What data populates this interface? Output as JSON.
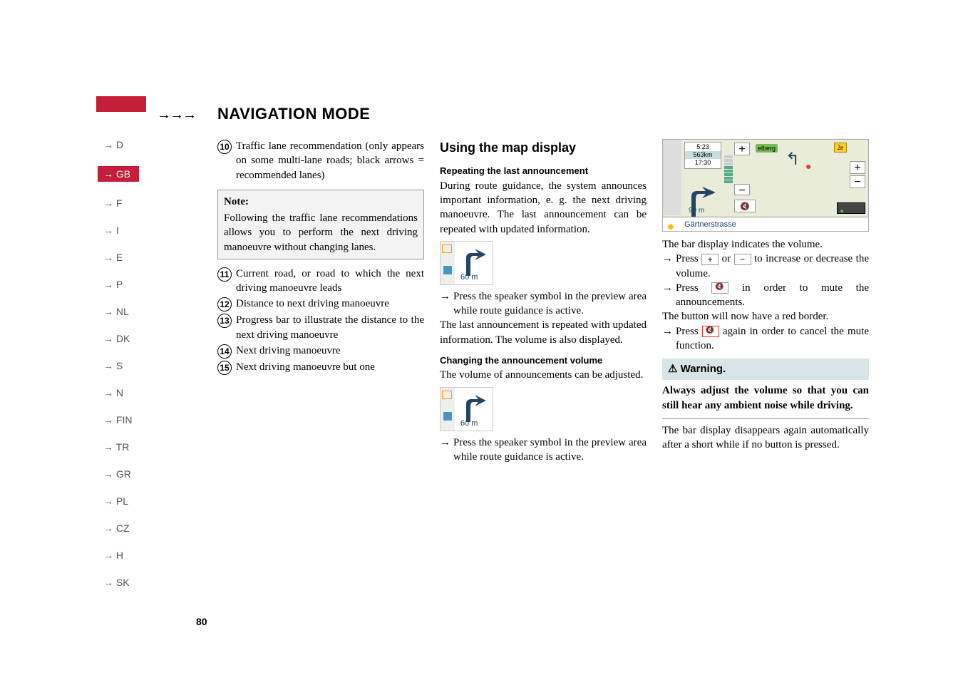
{
  "header": {
    "arrows": "→→→",
    "title": "NAVIGATION MODE"
  },
  "sidebar": {
    "items": [
      {
        "label": "→ D"
      },
      {
        "label": "→ GB",
        "active": true
      },
      {
        "label": "→ F"
      },
      {
        "label": "→ I"
      },
      {
        "label": "→ E"
      },
      {
        "label": "→ P"
      },
      {
        "label": "→ NL"
      },
      {
        "label": "→ DK"
      },
      {
        "label": "→ S"
      },
      {
        "label": "→ N"
      },
      {
        "label": "→ FIN"
      },
      {
        "label": "→ TR"
      },
      {
        "label": "→ GR"
      },
      {
        "label": "→ PL"
      },
      {
        "label": "→ CZ"
      },
      {
        "label": "→ H"
      },
      {
        "label": "→ SK"
      }
    ]
  },
  "page_num": "80",
  "col1": {
    "item10_num": "10",
    "item10_text": "Traffic lane recommendation (only appears on some multi-lane roads; black arrows = recommended lanes)",
    "note_title": "Note:",
    "note_body": "Following the traffic lane recommendations allows you to perform the next driving manoeuvre without changing lanes.",
    "item11_num": "11",
    "item11_text": "Current road, or road to which the next driving manoeuvre leads",
    "item12_num": "12",
    "item12_text": "Distance to next driving manoeuvre",
    "item13_num": "13",
    "item13_text": "Progress bar to illustrate the distance to the next driving manoeuvre",
    "item14_num": "14",
    "item14_text": "Next driving manoeuvre",
    "item15_num": "15",
    "item15_text": "Next driving manoeuvre but one"
  },
  "col2": {
    "heading": "Using the map display",
    "sub1": "Repeating the last announcement",
    "p1": "During route guidance, the system announces important information, e. g. the next driving manoeuvre. The last announcement can be repeated with updated information.",
    "dist1": "60 m",
    "step1": "Press the speaker symbol in the preview area while route guidance is active.",
    "p2": "The last announcement is repeated with updated information. The volume is also displayed.",
    "sub2": "Changing the announcement volume",
    "p3": "The volume of announcements can be adjusted.",
    "dist2": "60 m",
    "step2": "Press the speaker symbol in the preview area while route guidance is active."
  },
  "col3": {
    "nav": {
      "time": "5:23",
      "km": "563km",
      "clock": "17:30",
      "dist": "90 m",
      "street": "Gärtnerstrasse",
      "label": "elberg"
    },
    "p1": "The bar display indicates the volume.",
    "step1a": "Press ",
    "step1b": " or ",
    "step1c": " to increase or decrease the volume.",
    "step2a": "Press ",
    "step2b": " in order to mute the announcements.",
    "p2": "The button will now have a red border.",
    "step3a": "Press ",
    "step3b": " again in order to cancel the mute function.",
    "warn_heading": "⚠ Warning.",
    "warn_body": "Always adjust the volume so that you can still hear any ambient noise while driving.",
    "p3": "The bar display disappears again automatically after a short while if no button is pressed."
  }
}
